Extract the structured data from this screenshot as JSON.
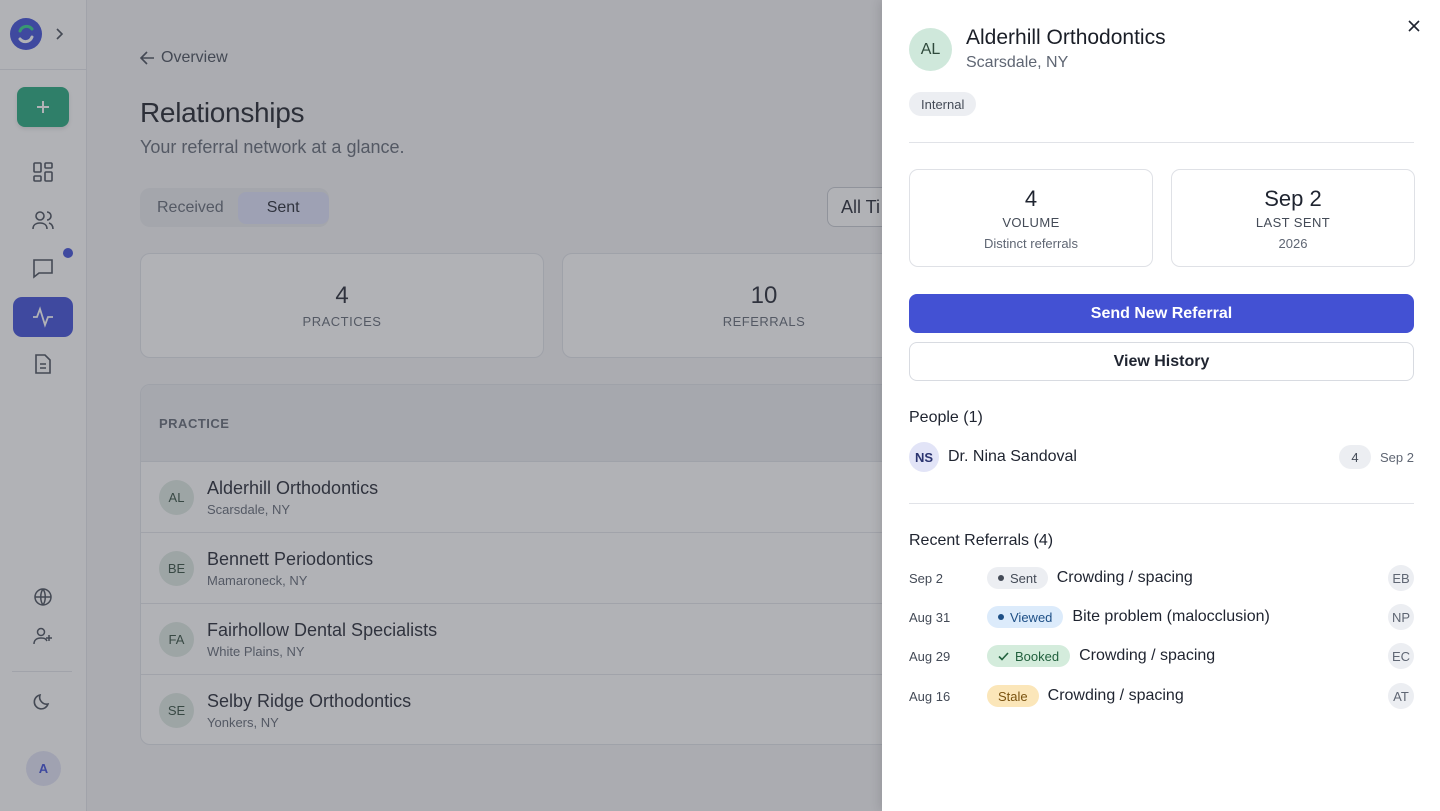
{
  "sidebar": {
    "user_initial": "A",
    "accent_color": "#3b4bd8",
    "add_color": "#1fa77a"
  },
  "main": {
    "back_label": "Overview",
    "title": "Relationships",
    "subtitle": "Your referral network at a glance.",
    "segment": {
      "options": [
        "Received",
        "Sent"
      ],
      "selected": "Sent"
    },
    "time_filter": "All Ti",
    "stats": [
      {
        "value": "4",
        "label": "PRACTICES"
      },
      {
        "value": "10",
        "label": "REFERRALS"
      }
    ],
    "table": {
      "header": "PRACTICE",
      "rows": [
        {
          "initials": "AL",
          "name": "Alderhill Orthodontics",
          "location": "Scarsdale, NY"
        },
        {
          "initials": "BE",
          "name": "Bennett Periodontics",
          "location": "Mamaroneck, NY"
        },
        {
          "initials": "FA",
          "name": "Fairhollow Dental Specialists",
          "location": "White Plains, NY"
        },
        {
          "initials": "SE",
          "name": "Selby Ridge Orthodontics",
          "location": "Yonkers, NY"
        }
      ]
    }
  },
  "panel": {
    "initials": "AL",
    "name": "Alderhill Orthodontics",
    "location": "Scarsdale, NY",
    "badge": "Internal",
    "volume": {
      "value": "4",
      "label": "VOLUME",
      "sub": "Distinct referrals"
    },
    "last_sent": {
      "value": "Sep 2",
      "label": "LAST SENT",
      "sub": "2026"
    },
    "send_button": "Send New Referral",
    "history_button": "View History",
    "people_title": "People (1)",
    "people": [
      {
        "initials": "NS",
        "name": "Dr. Nina Sandoval",
        "count": "4",
        "date": "Sep 2"
      }
    ],
    "recent_title": "Recent Referrals (4)",
    "referrals": [
      {
        "date": "Sep 2",
        "status": "Sent",
        "reason": "Crowding / spacing",
        "initials": "EB"
      },
      {
        "date": "Aug 31",
        "status": "Viewed",
        "reason": "Bite problem (malocclusion)",
        "initials": "NP"
      },
      {
        "date": "Aug 29",
        "status": "Booked",
        "reason": "Crowding / spacing",
        "initials": "EC"
      },
      {
        "date": "Aug 16",
        "status": "Stale",
        "reason": "Crowding / spacing",
        "initials": "AT"
      }
    ]
  }
}
